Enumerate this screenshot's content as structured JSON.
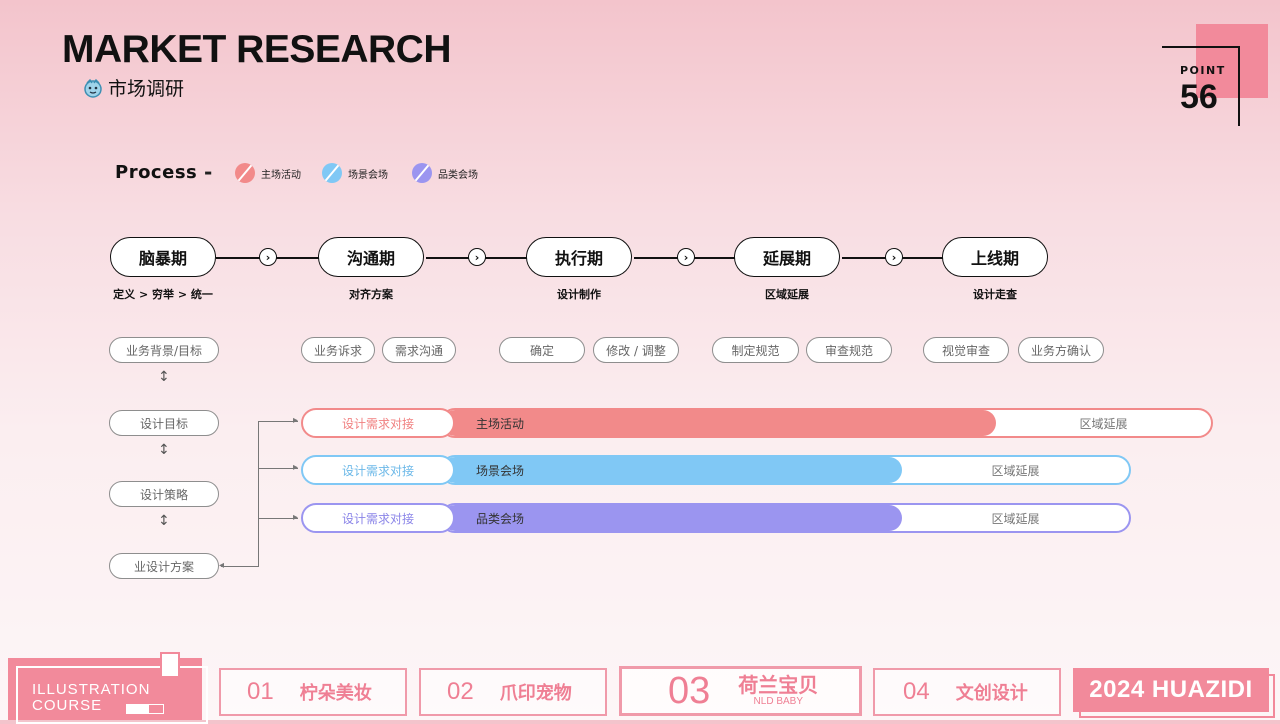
{
  "header": {
    "title": "MARKET RESEARCH",
    "subtitle": "市场调研",
    "point_label": "POINT",
    "point_number": "56"
  },
  "process": {
    "label": "Process",
    "dash": "-",
    "legend": [
      {
        "label": "主场活动",
        "color": "#f28a8a"
      },
      {
        "label": "场景会场",
        "color": "#80c8f5"
      },
      {
        "label": "品类会场",
        "color": "#9b95f0"
      }
    ]
  },
  "phases": [
    {
      "name": "脑暴期",
      "desc": "定义 > 穷举 > 统一"
    },
    {
      "name": "沟通期",
      "desc": "对齐方案"
    },
    {
      "name": "执行期",
      "desc": "设计制作"
    },
    {
      "name": "延展期",
      "desc": "区域延展"
    },
    {
      "name": "上线期",
      "desc": "设计走查"
    }
  ],
  "tasks": [
    "业务背景/目标",
    "业务诉求",
    "需求沟通",
    "确定",
    "修改 / 调整",
    "制定规范",
    "审查规范",
    "视觉审查",
    "业务方确认"
  ],
  "steps": [
    "设计目标",
    "设计策略",
    "业设计方案"
  ],
  "tracks": [
    {
      "start": "设计需求对接",
      "fill_label": "主场活动",
      "rest_label": "区域延展",
      "color": "#f28a8a",
      "progress": 0.72
    },
    {
      "start": "设计需求对接",
      "fill_label": "场景会场",
      "rest_label": "区域延展",
      "color": "#80c8f5",
      "progress": 0.67
    },
    {
      "start": "设计需求对接",
      "fill_label": "品类会场",
      "rest_label": "区域延展",
      "color": "#9b95f0",
      "progress": 0.67
    }
  ],
  "footer": {
    "illus_line1": "ILLUSTRATION",
    "illus_line2": "COURSE",
    "tabs": [
      {
        "num": "01",
        "label": "柠朵美妆"
      },
      {
        "num": "02",
        "label": "爪印宠物"
      },
      {
        "num": "03",
        "label": "荷兰宝贝",
        "sub": "NLD BABY"
      },
      {
        "num": "04",
        "label": "文创设计"
      }
    ],
    "brand": "2024 HUAZIDI"
  }
}
